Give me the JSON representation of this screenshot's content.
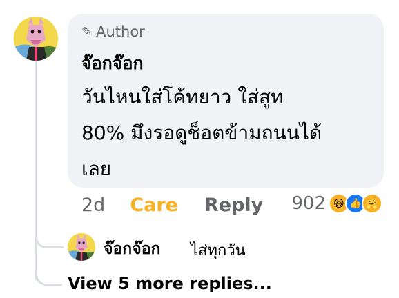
{
  "comment": {
    "badge_label": "Author",
    "badge_icon": "pencil-icon",
    "author_name": "จ๊อกจ๊อก",
    "text_lines": [
      "วันไหนใส่โค้ทยาว ใส่สูท",
      "80% มึงรอดูช็อตข้ามถนนได้",
      "เลย"
    ],
    "actions": {
      "time": "2d",
      "reaction_label": "Care",
      "reply_label": "Reply"
    },
    "reactions": {
      "count": "902",
      "icons": [
        "haha-reaction-icon",
        "like-reaction-icon",
        "care-reaction-icon"
      ]
    }
  },
  "reply_preview": {
    "author_name": "จ๊อกจ๊อก",
    "text": "ไส่ทุกวัน"
  },
  "view_more_label": "View 5 more replies...",
  "colors": {
    "bubble_bg": "#f0f2f5",
    "secondary_text": "#65676b",
    "care_accent": "#f7b125",
    "like_blue": "#1877f2",
    "thread_line": "#dadde1"
  }
}
